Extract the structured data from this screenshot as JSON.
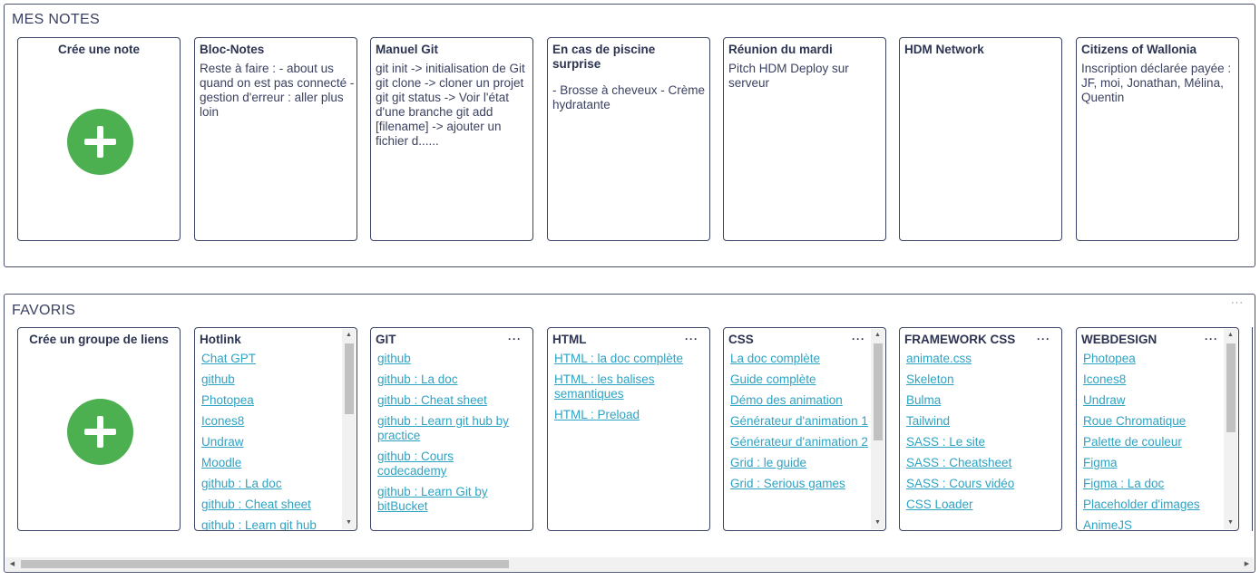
{
  "notes": {
    "title": "MES NOTES",
    "create_label": "Crée une note",
    "cards": [
      {
        "title": "Bloc-Notes",
        "body": "Reste à faire : - about us quand on est pas connecté - gestion d'erreur : aller plus loin"
      },
      {
        "title": "Manuel Git",
        "body": "git init -> initialisation de Git git clone -> cloner un projet git git status -> Voir l'état d'une branche git add [filename] -> ajouter un fichier d......"
      },
      {
        "title": "En cas de piscine surprise",
        "body": "- Brosse à cheveux - Crème hydratante"
      },
      {
        "title": "Réunion du mardi",
        "body": "Pitch HDM Deploy sur serveur"
      },
      {
        "title": "HDM Network",
        "body": ""
      },
      {
        "title": "Citizens of Wallonia",
        "body": "Inscription déclarée payée : JF, moi, Jonathan, Mélina, Quentin"
      }
    ]
  },
  "favoris": {
    "title": "FAVORIS",
    "more": "···",
    "create_label": "Crée un groupe de liens",
    "groups": [
      {
        "title": "Hotlink",
        "more": "",
        "links": [
          "Chat GPT",
          "github",
          "Photopea",
          "Icones8",
          "Undraw",
          "Moodle",
          "github : La doc",
          "github : Cheat sheet",
          "github : Learn git hub"
        ],
        "scroll": {
          "fraction": 0.4
        }
      },
      {
        "title": "GIT",
        "more": "···",
        "links": [
          "github",
          "github : La doc",
          "github : Cheat sheet",
          "github : Learn git hub by practice",
          "github : Cours codecademy",
          "github : Learn Git by bitBucket"
        ]
      },
      {
        "title": "HTML",
        "more": "···",
        "links": [
          "HTML : la doc complète",
          "HTML : les balises semantiques",
          "HTML : Preload"
        ]
      },
      {
        "title": "CSS",
        "more": "···",
        "links": [
          "La doc complète",
          "Guide complète",
          "Démo des animation",
          "Générateur d'animation 1",
          "Générateur d'animation 2",
          "Grid : le guide",
          "Grid : Serious games"
        ],
        "scroll": {
          "fraction": 0.55
        }
      },
      {
        "title": "FRAMEWORK CSS",
        "more": "···",
        "links": [
          "animate.css",
          "Skeleton",
          "Bulma",
          "Tailwind",
          "SASS : Le site",
          "SASS : Cheatsheet",
          "SASS : Cours vidéo",
          "CSS Loader"
        ]
      },
      {
        "title": "WEBDESIGN",
        "more": "···",
        "links": [
          "Photopea",
          "Icones8",
          "Undraw",
          "Roue Chromatique",
          "Palette de couleur",
          "Figma",
          "Figma : La doc",
          "Placeholder d'images",
          "AnimeJS"
        ],
        "scroll": {
          "fraction": 0.5
        }
      }
    ],
    "hscroll": {
      "fraction": 0.4
    }
  },
  "colors": {
    "accent": "#4caf50",
    "link": "#2ea3c3",
    "border": "#3c4466",
    "text": "#2c3451"
  }
}
